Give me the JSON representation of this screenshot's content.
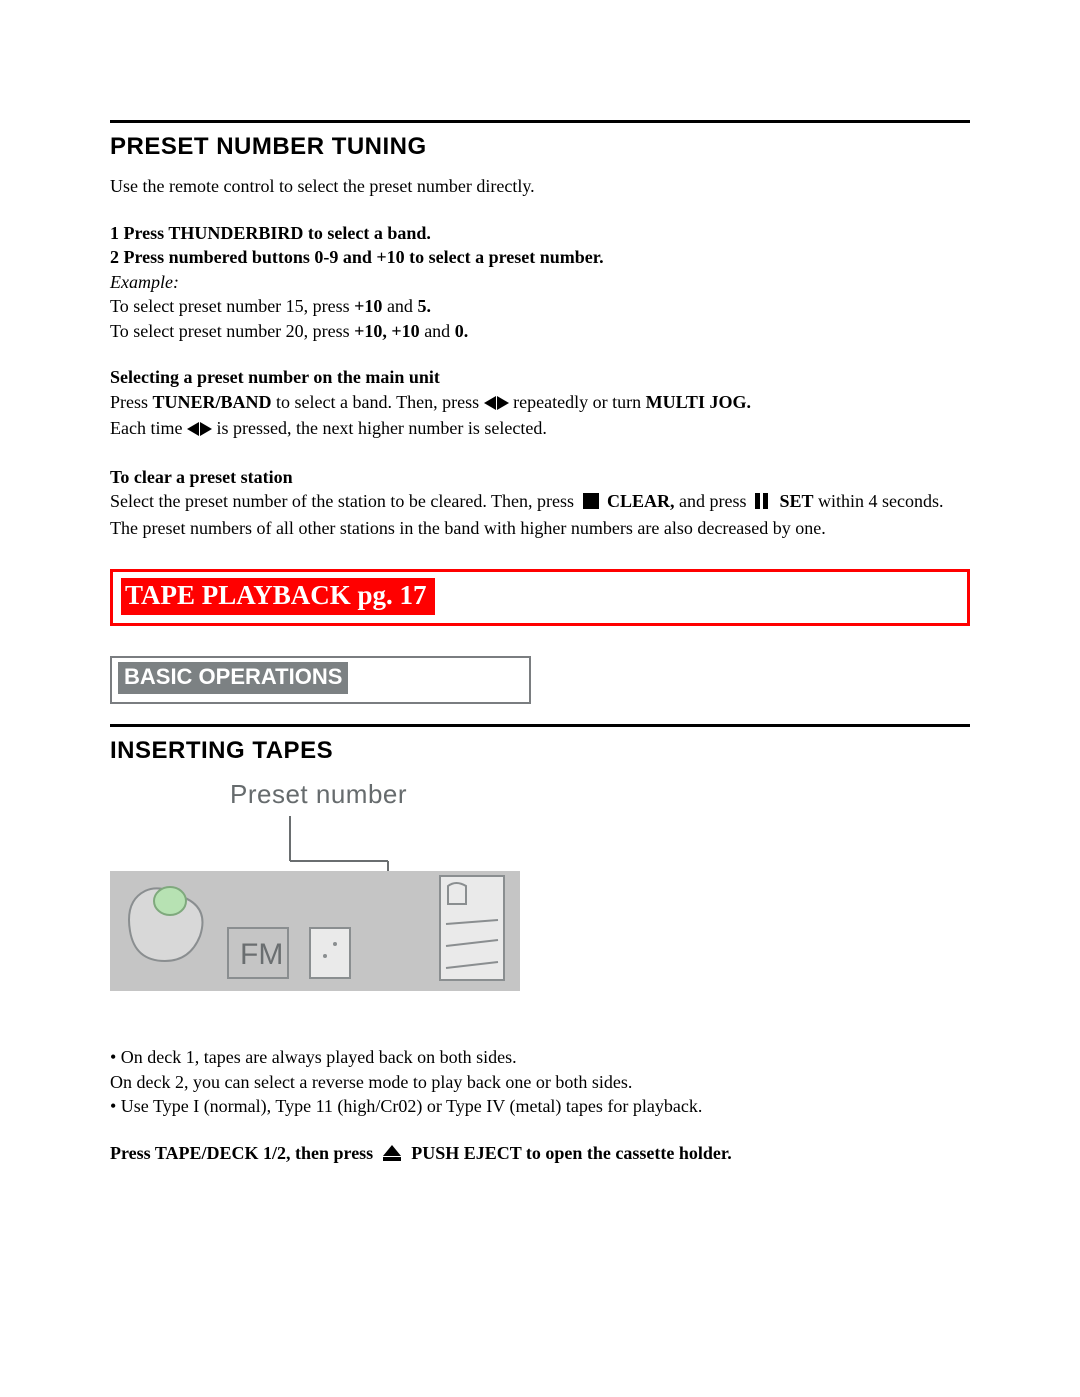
{
  "preset": {
    "heading": "PRESET NUMBER TUNING",
    "intro": "Use the remote control to select the preset number directly.",
    "step1_prefix": "1 Press THUNDERBIRD to select a band.",
    "step2_prefix": "2 Press numbered buttons 0-9 and +10 to select a preset number.",
    "example_label": "Example:",
    "ex1_a": "To select preset number 15, press ",
    "ex1_b": "+10",
    "ex1_c": " and ",
    "ex1_d": "5.",
    "ex2_a": "To select preset number 20, press ",
    "ex2_b": "+10, +10",
    "ex2_c": " and ",
    "ex2_d": "0.",
    "main_unit_heading": "Selecting a preset number on the main unit",
    "mu_a": "Press ",
    "mu_b": "TUNER/BAND",
    "mu_c": " to select a band. Then, press ",
    "mu_d": " repeatedly or turn ",
    "mu_e": "MULTI JOG.",
    "mu2_a": "Each time ",
    "mu2_b": " is pressed, the next higher number is selected.",
    "clear_heading": "To clear a preset station",
    "clr_a": "Select the preset number of the station to be cleared. Then, press ",
    "clr_b": "CLEAR,",
    "clr_c": " and press ",
    "clr_d": "SET",
    "clr_e": " within 4 seconds.",
    "clr_f": "The preset numbers of all other stations in the band with higher numbers are also decreased by one."
  },
  "tape": {
    "title_box": "TAPE PLAYBACK  pg. 17",
    "basic_ops": "BASIC OPERATIONS",
    "insert_heading": "INSERTING TAPES",
    "illus_label": "Preset number",
    "illus_fm": "FM",
    "bul1": "• On deck 1, tapes are always played back on both sides.",
    "deck2": "On deck 2, you can select a reverse mode to play back one or both sides.",
    "bul2": "• Use Type I (normal), Type 11 (high/Cr02) or Type IV (metal) tapes for playback.",
    "press_a": "Press TAPE/DECK 1/2,  then press ",
    "press_b": " PUSH EJECT to open the cassette holder."
  }
}
